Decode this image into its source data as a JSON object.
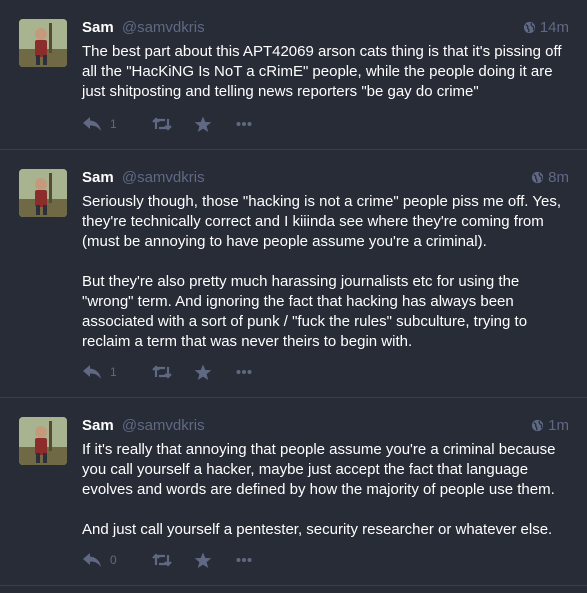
{
  "statuses": [
    {
      "display_name": "Sam",
      "handle": "@samvdkris",
      "time": "14m",
      "paragraphs": [
        "The best part about this APT42069 arson cats thing is that it's pissing off all the \"HacKiNG Is NoT a cRimE\" people, while the people doing it are just shitposting and telling news reporters \"be gay do crime\""
      ],
      "reply_count": "1"
    },
    {
      "display_name": "Sam",
      "handle": "@samvdkris",
      "time": "8m",
      "paragraphs": [
        "Seriously though, those \"hacking is not a crime\" people piss me off. Yes, they're technically correct and I kiiinda see where they're coming from (must be annoying to have people assume you're a criminal).",
        "But they're also pretty much harassing journalists etc for using the \"wrong\" term. And ignoring the fact that hacking has always been associated with a sort of punk / \"fuck the rules\" subculture, trying to reclaim a term that was never theirs to begin with."
      ],
      "reply_count": "1"
    },
    {
      "display_name": "Sam",
      "handle": "@samvdkris",
      "time": "1m",
      "paragraphs": [
        "If it's really that annoying that people assume you're a criminal because you call yourself a hacker, maybe just accept the fact that language evolves and words are defined by how the majority of people use them.",
        "And just call yourself a pentester, security researcher or whatever else."
      ],
      "reply_count": "0"
    }
  ],
  "icons": {
    "visibility": "globe-icon",
    "reply": "reply-icon",
    "boost": "boost-icon",
    "favourite": "star-icon",
    "more": "ellipsis-icon"
  },
  "colors": {
    "background": "#282c37",
    "muted_text": "#606984",
    "text": "#ffffff",
    "divider": "#393f4f"
  }
}
